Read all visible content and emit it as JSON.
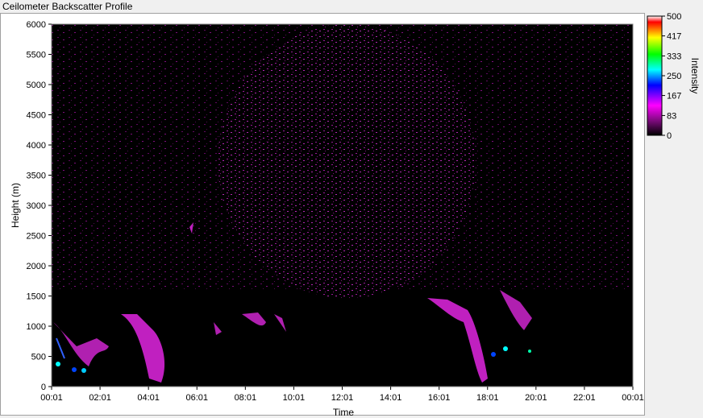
{
  "window": {
    "title": "Ceilometer Backscatter Profile"
  },
  "chart_data": {
    "type": "heatmap",
    "title": "Ceilometer Backscatter Profile",
    "xlabel": "Time",
    "ylabel": "Height (m)",
    "x_ticks": [
      "00:01",
      "02:01",
      "04:01",
      "06:01",
      "08:01",
      "10:01",
      "12:01",
      "14:01",
      "16:01",
      "18:01",
      "20:01",
      "22:01",
      "00:01"
    ],
    "y_ticks": [
      0,
      500,
      1000,
      1500,
      2000,
      2500,
      3000,
      3500,
      4000,
      4500,
      5000,
      5500,
      6000
    ],
    "ylim": [
      0,
      6000
    ],
    "colorbar": {
      "label": "Intensity",
      "ticks": [
        500,
        417,
        333,
        250,
        167,
        83,
        0
      ],
      "range": [
        0,
        500
      ],
      "colors": [
        "#000000",
        "#7a0a7a",
        "#ff00ff",
        "#0000ff",
        "#00ffff",
        "#00ff00",
        "#ffff00",
        "#ff0000",
        "#ffffff"
      ]
    },
    "grid": false
  }
}
